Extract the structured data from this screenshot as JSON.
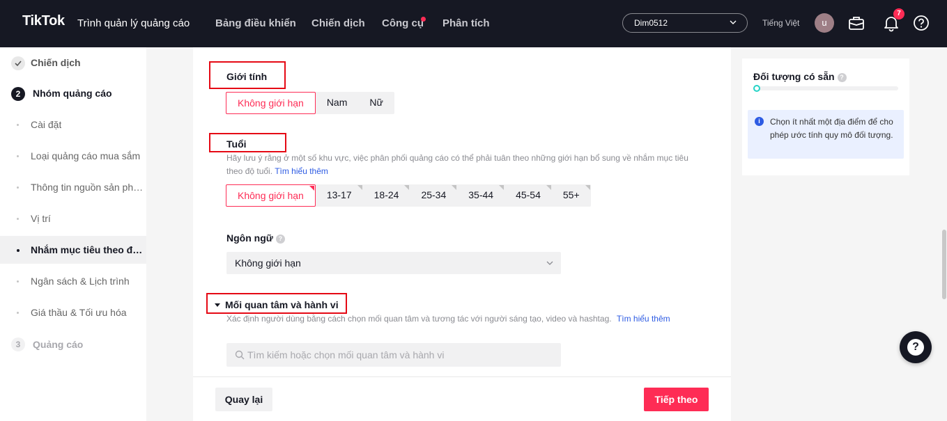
{
  "header": {
    "logo": "TikTok",
    "logo_sub": "Trình quản lý quảng cáo",
    "nav": [
      "Bảng điều khiển",
      "Chiến dịch",
      "Công cụ",
      "Phân tích"
    ],
    "account": "Dim0512",
    "language": "Tiếng Việt",
    "avatar_initial": "u",
    "notification_count": "7"
  },
  "sidebar": {
    "steps": [
      {
        "label": "Chiến dịch",
        "state": "done"
      },
      {
        "label": "Nhóm quảng cáo",
        "number": "2",
        "state": "current"
      },
      {
        "label": "Quảng cáo",
        "number": "3",
        "state": "pending"
      }
    ],
    "substeps": [
      "Cài đặt",
      "Loại quảng cáo mua sắm",
      "Thông tin nguồn sản phẩm",
      "Vị trí",
      "Nhắm mục tiêu theo đối tượng",
      "Ngân sách & Lịch trình",
      "Giá thầu & Tối ưu hóa"
    ],
    "active_substep": "Nhắm mục tiêu theo đối tượng"
  },
  "gender": {
    "title": "Giới tính",
    "options": [
      "Không giới hạn",
      "Nam",
      "Nữ"
    ],
    "selected": "Không giới hạn"
  },
  "age": {
    "title": "Tuổi",
    "hint": "Hãy lưu ý rằng ở một số khu vực, việc phân phối quảng cáo có thể phải tuân theo những giới hạn bổ sung về nhắm mục tiêu theo độ tuổi.",
    "hint_link": "Tìm hiểu thêm",
    "options": [
      "Không giới hạn",
      "13-17",
      "18-24",
      "25-34",
      "35-44",
      "45-54",
      "55+"
    ],
    "selected": "Không giới hạn"
  },
  "language_field": {
    "title": "Ngôn ngữ",
    "value": "Không giới hạn"
  },
  "interests": {
    "title": "Mối quan tâm và hành vi",
    "hint": "Xác định người dùng bằng cách chọn mối quan tâm và tương tác với người sáng tạo, video và hashtag.",
    "hint_link": "Tìm hiểu thêm",
    "search_placeholder": "Tìm kiếm hoặc chọn mối quan tâm và hành vi"
  },
  "footer": {
    "back": "Quay lại",
    "next": "Tiếp theo"
  },
  "audience_panel": {
    "title": "Đối tượng có sẵn",
    "info": "Chọn ít nhất một địa điểm để cho phép ước tính quy mô đối tượng."
  },
  "colors": {
    "brand": "#fe2c55",
    "topbar": "#161823",
    "highlight_box": "#e50914",
    "link": "#2d5be3"
  }
}
